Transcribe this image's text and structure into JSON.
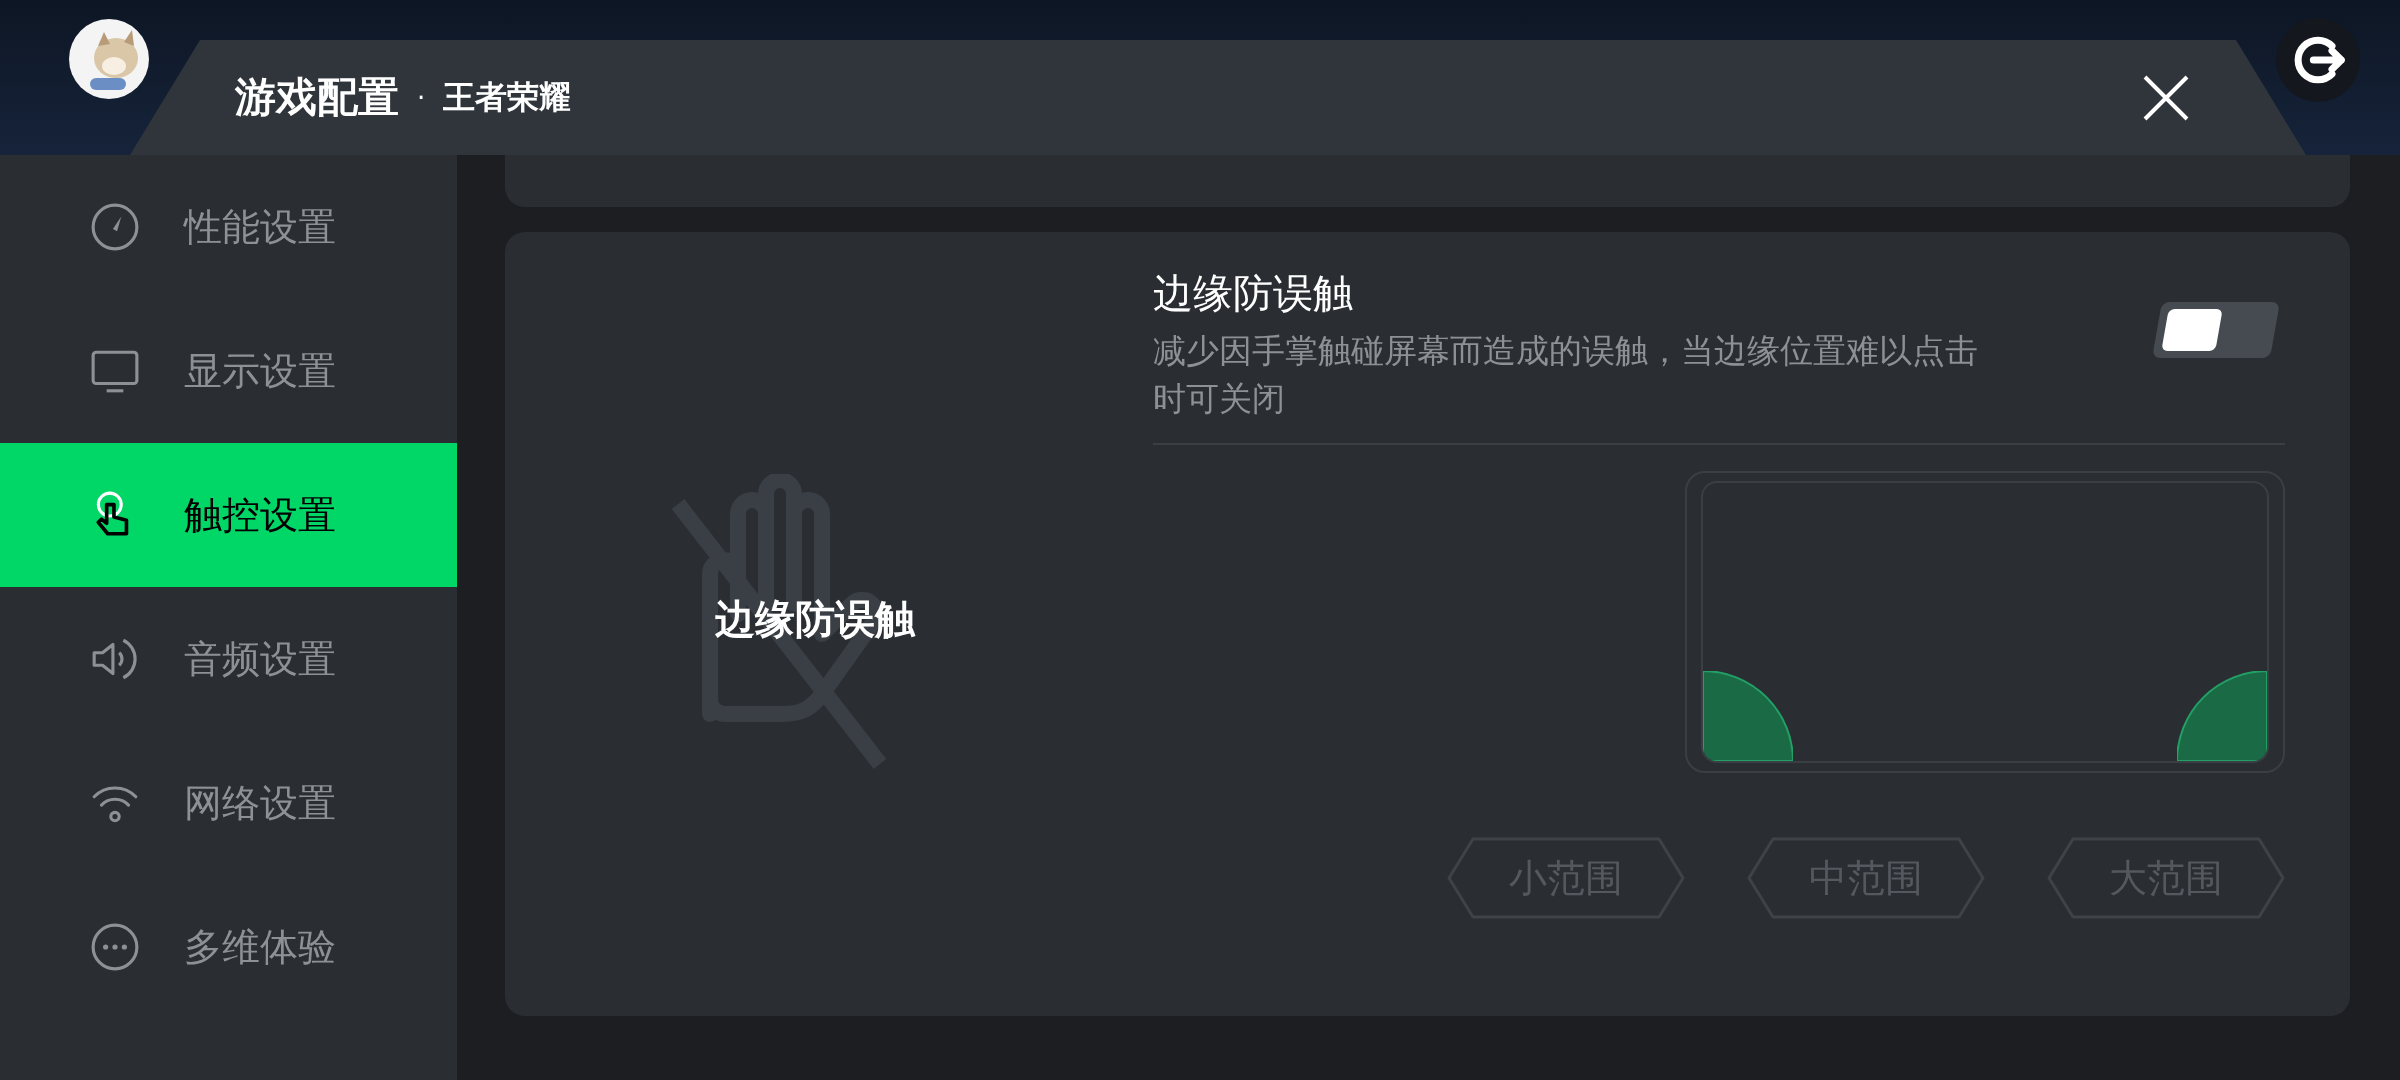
{
  "header": {
    "title": "游戏配置",
    "separator": "·",
    "game": "王者荣耀"
  },
  "sidebar": {
    "items": [
      {
        "label": "性能设置",
        "selected": false
      },
      {
        "label": "显示设置",
        "selected": false
      },
      {
        "label": "触控设置",
        "selected": true
      },
      {
        "label": "音频设置",
        "selected": false
      },
      {
        "label": "网络设置",
        "selected": false
      },
      {
        "label": "多维体验",
        "selected": false
      }
    ]
  },
  "feature": {
    "label": "边缘防误触",
    "title": "边缘防误触",
    "description": "减少因手掌触碰屏幕而造成的误触，当边缘位置难以点击时可关闭",
    "on": false
  },
  "ranges": [
    {
      "label": "小范围",
      "disabled": true
    },
    {
      "label": "中范围",
      "disabled": true
    },
    {
      "label": "大范围",
      "disabled": true
    }
  ]
}
